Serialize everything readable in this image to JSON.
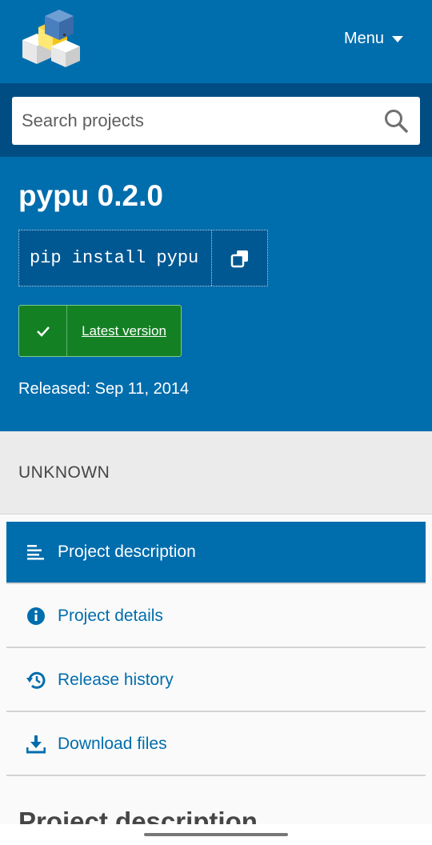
{
  "header": {
    "menu_label": "Menu",
    "logo_icon": "pypi-logo-icon"
  },
  "search": {
    "placeholder": "Search projects",
    "value": "",
    "icon": "search-icon"
  },
  "package": {
    "title": "pypu 0.2.0",
    "pip_command": "pip install pypu",
    "copy_icon": "copy-icon",
    "badge_label": "Latest version",
    "badge_icon": "check-icon",
    "released": "Released: Sep 11, 2014"
  },
  "license": {
    "text": "UNKNOWN"
  },
  "nav": {
    "items": [
      {
        "label": "Project description",
        "icon": "align-left-icon",
        "active": true
      },
      {
        "label": "Project details",
        "icon": "info-circle-icon",
        "active": false
      },
      {
        "label": "Release history",
        "icon": "history-icon",
        "active": false
      },
      {
        "label": "Download files",
        "icon": "download-icon",
        "active": false
      }
    ]
  },
  "section": {
    "title": "Project description"
  },
  "colors": {
    "brand_blue": "#006dad",
    "dark_blue": "#004d84",
    "badge_green": "#148024"
  }
}
